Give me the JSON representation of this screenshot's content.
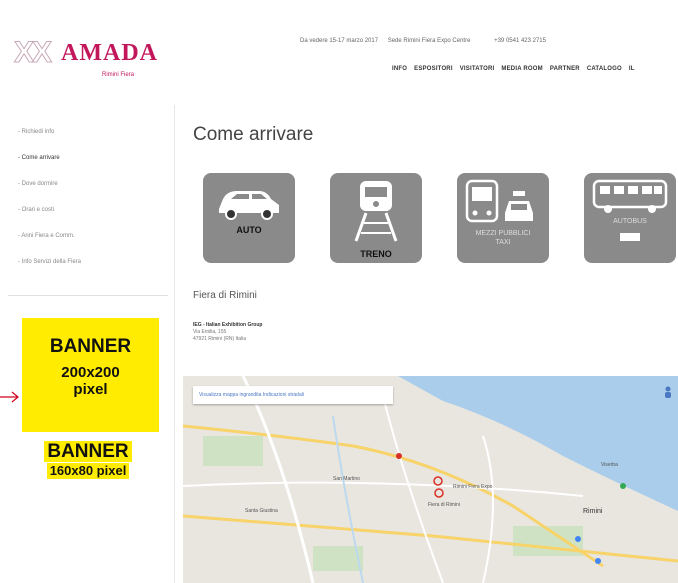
{
  "header": {
    "logo_text": "AMADA",
    "logo_outline": "XX",
    "logo_sub": "Rimini Fiera",
    "dates": "Da vedere 15-17 marzo 2017",
    "venue": "Sede Rimini Fiera Expo Centre",
    "phone": "+39 0541 423 2715",
    "nav": [
      "INFO",
      "ESPOSITORI",
      "VISITATORI",
      "MEDIA ROOM",
      "PARTNER",
      "CATALOGO",
      "IL"
    ]
  },
  "sidebar": {
    "items": [
      {
        "label": "- Richiedi info",
        "active": false
      },
      {
        "label": "- Come arrivare",
        "active": true
      },
      {
        "label": "- Dove dormire",
        "active": false
      },
      {
        "label": "- Orari e costi",
        "active": false
      },
      {
        "label": "- Anni Fiera e Comm.",
        "active": false
      },
      {
        "label": "- Info Servizi della Fiera",
        "active": false
      }
    ]
  },
  "banners": {
    "big_line1": "BANNER",
    "big_line2": "200x200",
    "big_line3": "pixel",
    "small_line1": "BANNER",
    "small_line2": "160x80 pixel"
  },
  "main": {
    "title": "Come arrivare",
    "tiles": [
      {
        "label": "AUTO"
      },
      {
        "label": "TRENO"
      },
      {
        "label": "MEZZI PUBBLICI TAXI"
      },
      {
        "label": "AUTOBUS"
      }
    ],
    "venue_title": "Fiera di Rimini",
    "venue_name": "IEG - Italian Exhibition Group",
    "venue_street": "Via Emilia, 155",
    "venue_city": "47921 Rimini (RN) Italia"
  },
  "map": {
    "search_text": "Visualizza mappa ingrandita   Indicazioni stradali",
    "labels": [
      "Rimini Fiera Expo",
      "Viserba",
      "Rimini",
      "Fiera di Rimini",
      "Santa Giustina",
      "San Martino"
    ]
  },
  "colors": {
    "accent": "#c2185b",
    "banner": "#ffec00",
    "tile": "#8a8a8a"
  }
}
